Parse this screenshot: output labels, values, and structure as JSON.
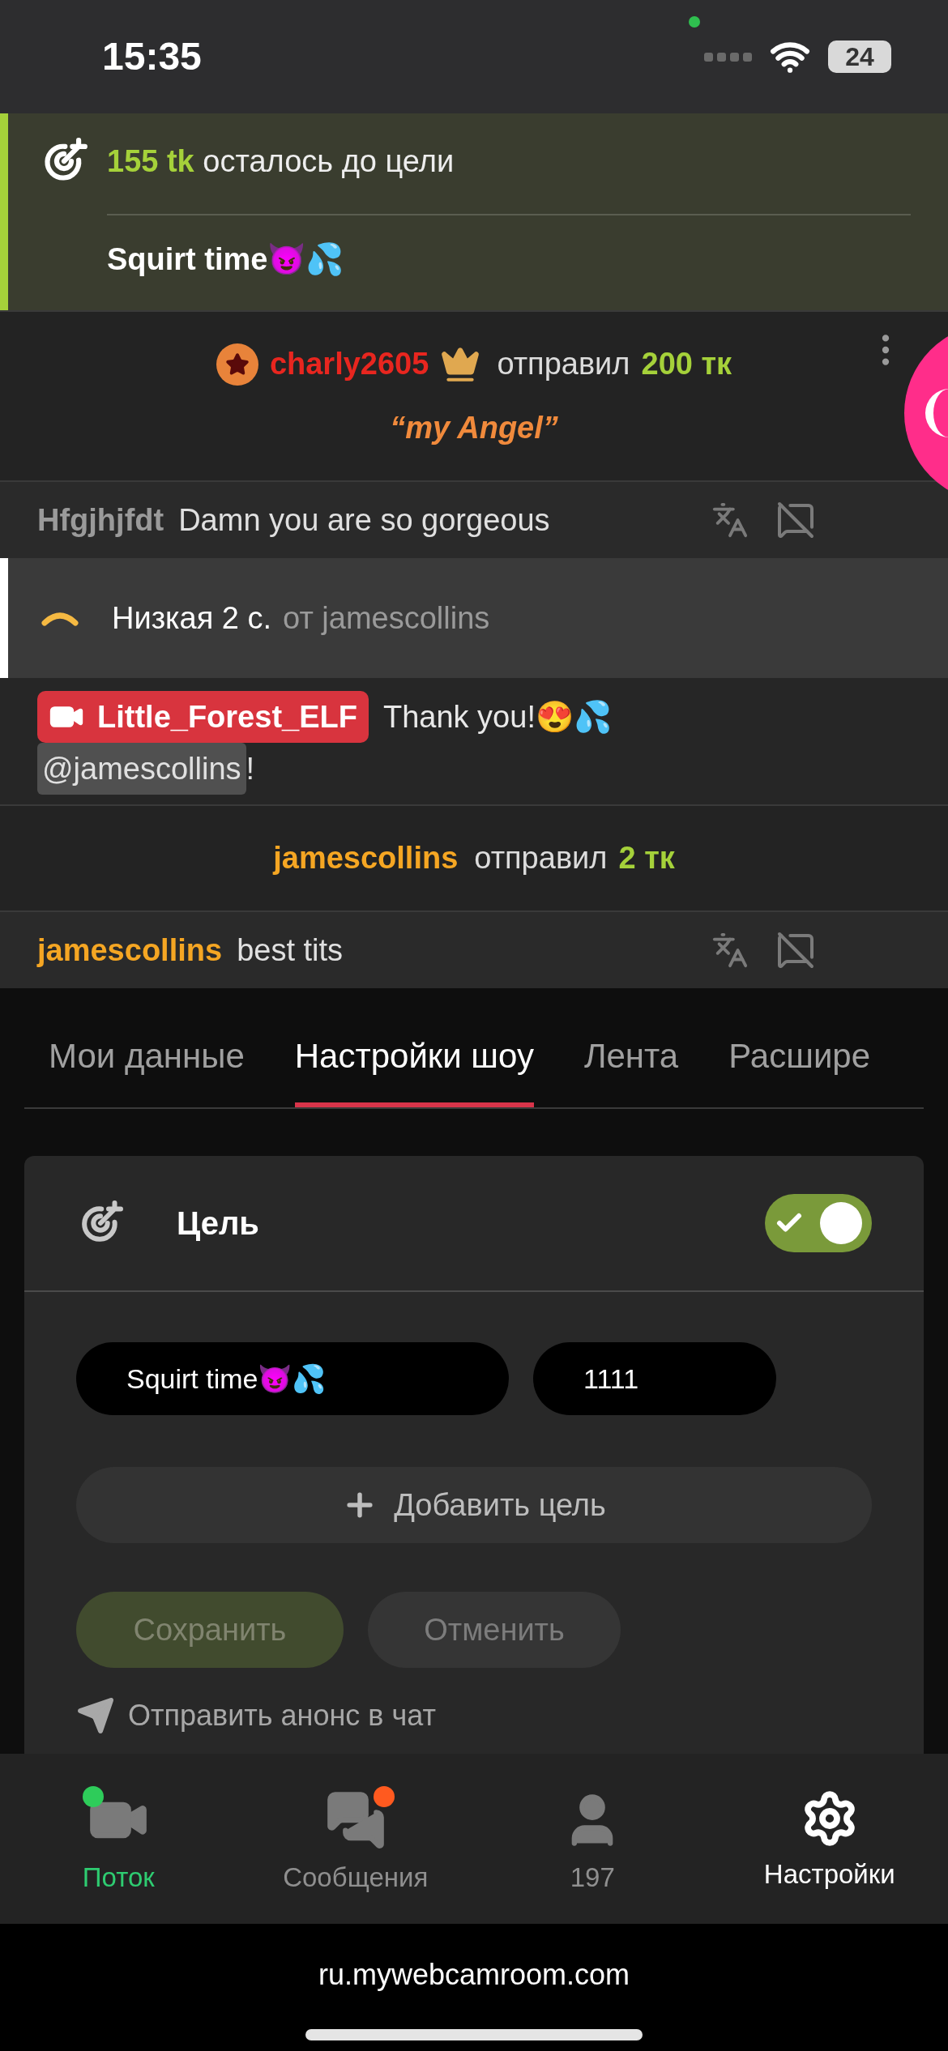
{
  "status_bar": {
    "time": "15:35",
    "battery": "24"
  },
  "goal_banner": {
    "amount": "155 tk",
    "text": "осталось до цели",
    "title": "Squirt time😈💦"
  },
  "chat": [
    {
      "kind": "tip",
      "user": "charly2605",
      "color": "#e8261f",
      "verb": "отправил",
      "amount": "200 тк",
      "note": "“my Angel”"
    },
    {
      "kind": "message",
      "user": "Hfgjhjfdt",
      "color": "#9a9a9a",
      "text": "Damn you are so gorgeous"
    },
    {
      "kind": "vibe",
      "label": "Низкая 2 с.",
      "from": "от jamescollins"
    },
    {
      "kind": "model_message",
      "user": "Little_Forest_ELF",
      "text": "Thank you!😍💦",
      "mention": "@jamescollins",
      "tail": "!"
    },
    {
      "kind": "tip",
      "user": "jamescollins",
      "color": "#f5a623",
      "verb": "отправил",
      "amount": "2 тк"
    },
    {
      "kind": "message",
      "user": "jamescollins",
      "color": "#f5a623",
      "text": "best tits"
    }
  ],
  "tabs": [
    {
      "label": "Мои данные",
      "selected": false
    },
    {
      "label": "Настройки шоу",
      "selected": true
    },
    {
      "label": "Лента",
      "selected": false
    },
    {
      "label": "Расшире",
      "selected": false
    }
  ],
  "goal_card": {
    "title": "Цель",
    "on": true,
    "goal_name": "Squirt time😈💦",
    "goal_amount": "1111",
    "add_label": "Добавить цель",
    "save": {
      "label": "Сохранить",
      "disabled": true
    },
    "cancel": {
      "label": "Отменить",
      "disabled": true
    },
    "announce_label": "Отправить анонс в чат"
  },
  "nav": [
    {
      "kind": "camera",
      "label": "Поток",
      "selected": false,
      "live": true,
      "color": "#2ecc5a"
    },
    {
      "kind": "chat",
      "label": "Сообщения",
      "selected": false,
      "color": "#ff5a1f"
    },
    {
      "kind": "person",
      "label": "197",
      "selected": false
    },
    {
      "kind": "gear",
      "label": "Настройки",
      "selected": true
    }
  ],
  "browser": {
    "url": "ru.mywebcamroom.com"
  }
}
